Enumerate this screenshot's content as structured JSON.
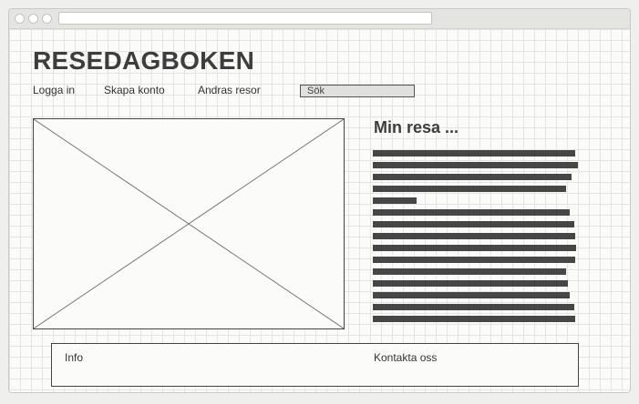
{
  "site": {
    "logo": "RESEDAGBOKEN"
  },
  "nav": {
    "login": "Logga in",
    "create_account": "Skapa konto",
    "other_trips": "Andras resor"
  },
  "search": {
    "value": "Sök"
  },
  "article": {
    "title": "Min resa ..."
  },
  "footer": {
    "info": "Info",
    "contact": "Kontakta oss"
  }
}
